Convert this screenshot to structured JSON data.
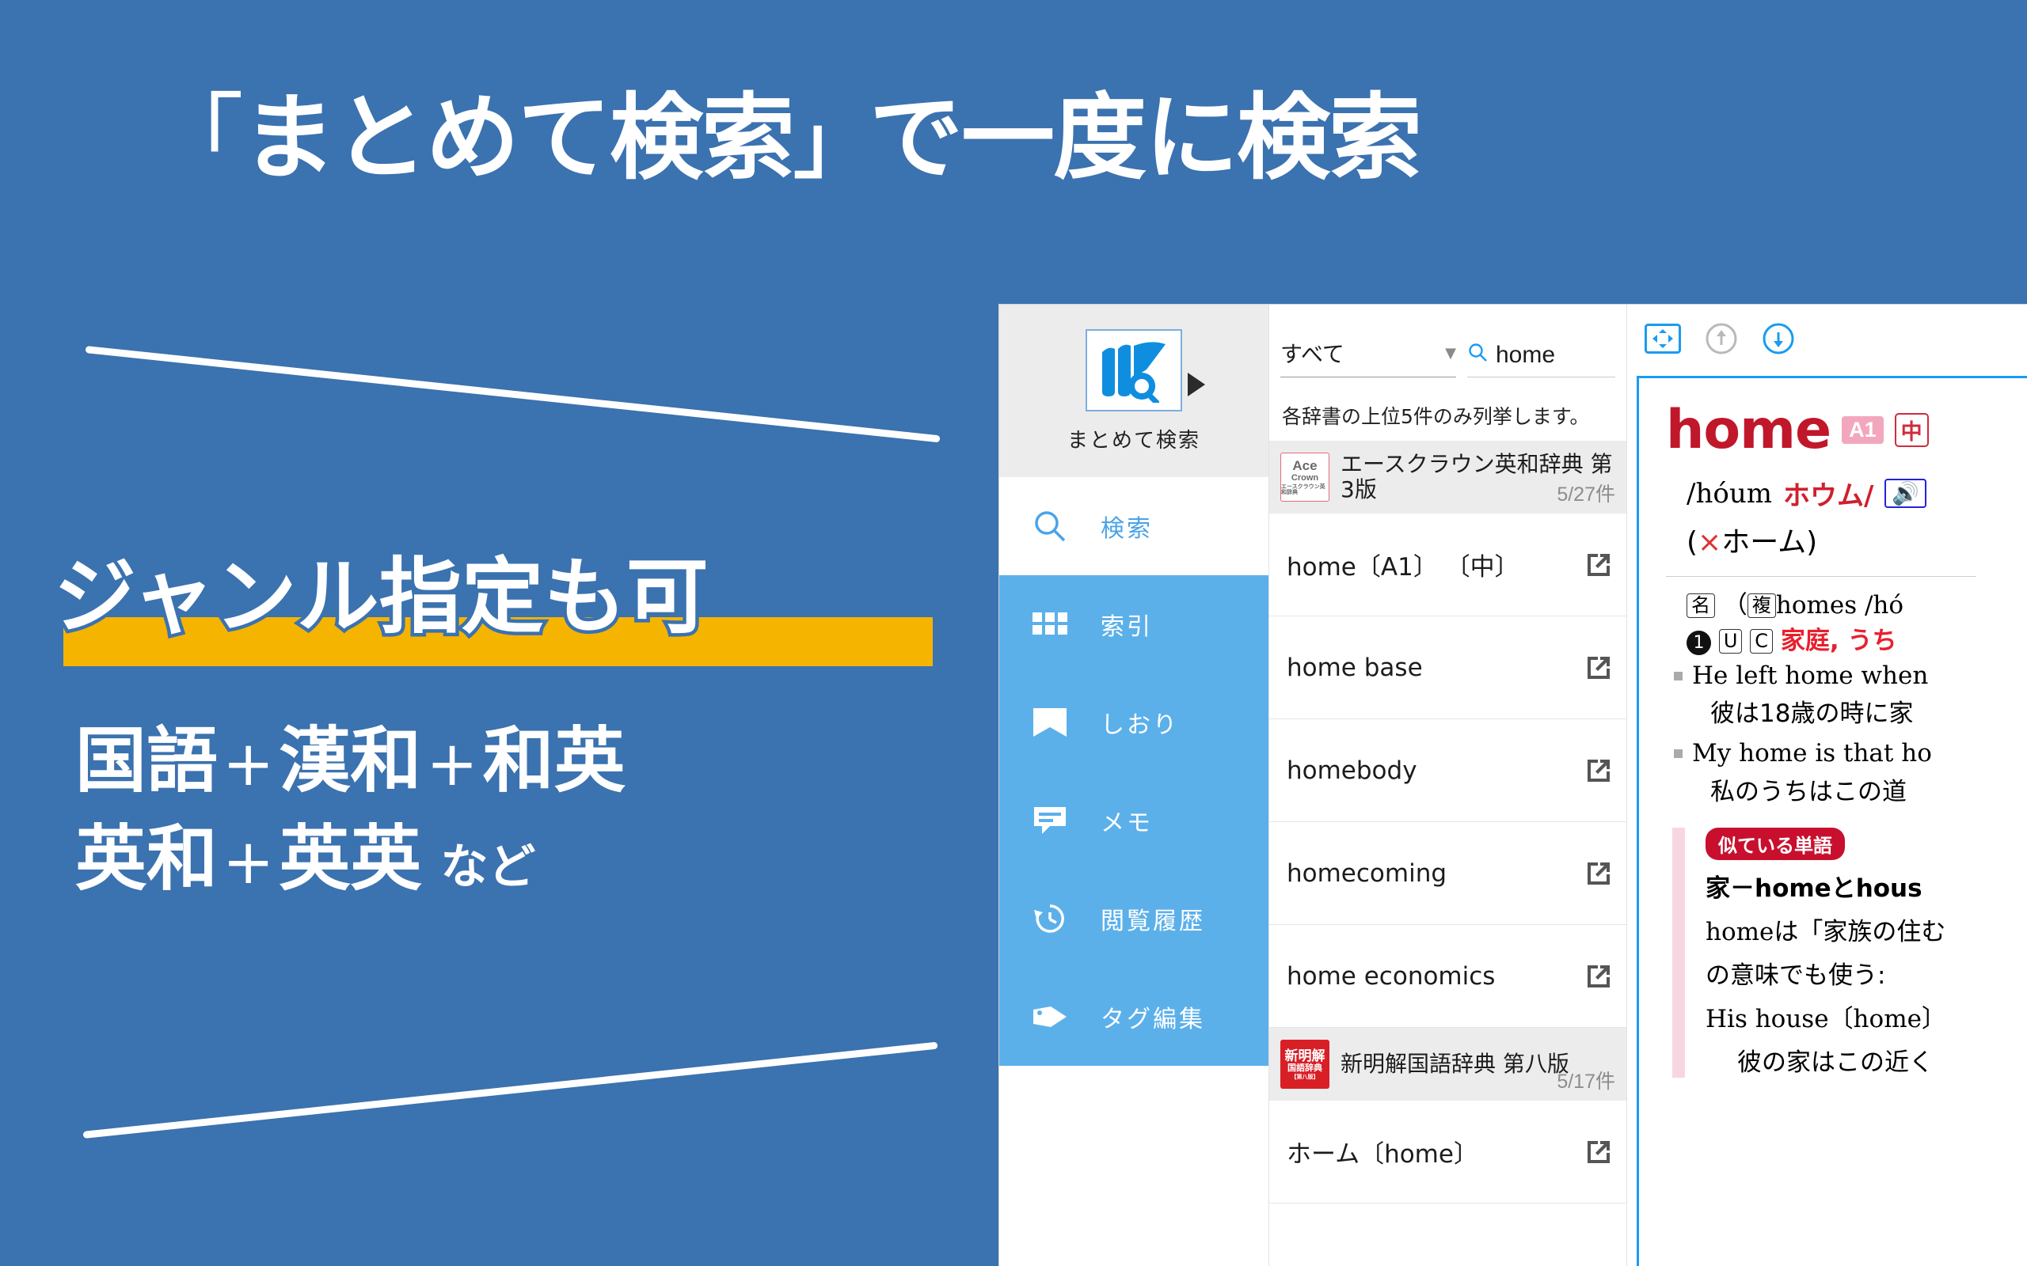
{
  "promo": {
    "headline_open": "「",
    "headline_main": "まとめて検索",
    "headline_close": "」",
    "headline_tail": "で一度に検索",
    "highlight_text": "ジャンル指定も可",
    "highlight_color": "#f5b400",
    "line1_a": "国語",
    "line1_plus1": "+",
    "line1_b": "漢和",
    "line1_plus2": "+",
    "line1_c": "和英",
    "line2_a": "英和",
    "line2_plus1": "+",
    "line2_b": "英英",
    "line2_nado": "など",
    "background_color": "#3b72b0"
  },
  "app": {
    "sidebar": {
      "brand_label": "まとめて検索",
      "items": [
        {
          "label": "検索",
          "icon": "search-icon",
          "active": true
        },
        {
          "label": "索引",
          "icon": "grid-icon",
          "active": false
        },
        {
          "label": "しおり",
          "icon": "bookmark-icon",
          "active": false
        },
        {
          "label": "メモ",
          "icon": "note-icon",
          "active": false
        },
        {
          "label": "閲覧履歴",
          "icon": "history-icon",
          "active": false
        },
        {
          "label": "タグ編集",
          "icon": "tag-icon",
          "active": false
        }
      ]
    },
    "search": {
      "genre_value": "すべて",
      "query_value": "home",
      "note": "各辞書の上位5件のみ列挙します。"
    },
    "result_groups": [
      {
        "logo_l1": "Ace",
        "logo_l2": "Crown",
        "logo_l3": "エースクラウン英和辞典",
        "title": "エースクラウン英和辞典 第3版",
        "count": "5/27件",
        "items": [
          {
            "label": "home〔A1〕 〔中〕"
          },
          {
            "label": "home base"
          },
          {
            "label": "homebody"
          },
          {
            "label": "homecoming"
          },
          {
            "label": "home economics"
          }
        ]
      },
      {
        "logo_l1": "新明解",
        "logo_l2": "国語辞典",
        "logo_l3": "【第八版】",
        "title": "新明解国語辞典 第八版",
        "count": "5/17件",
        "items": [
          {
            "label": "ホーム〔home〕"
          }
        ]
      }
    ],
    "detail": {
      "toolbar": [
        {
          "icon": "fit-screen-icon",
          "state": "active"
        },
        {
          "icon": "arrow-up-circle-icon",
          "state": "disabled"
        },
        {
          "icon": "arrow-down-circle-icon",
          "state": "active"
        }
      ],
      "headword": "home",
      "badge_level": "A1",
      "badge_level_color": "#f3a7bd",
      "badge_cj": "中",
      "badge_cj_color": "#d02b3e",
      "phonetic": "/hóum",
      "phonetic_kana": "ホウム/",
      "speaker_icon": "speaker-icon",
      "phonetic_note_x": "×",
      "phonetic_note": "ホーム)",
      "phonetic_note_open": "(",
      "pos_box": "名",
      "plural_box": "複",
      "plural_text": "homes /hó",
      "sense_num": "❶",
      "sense_box_u": "U",
      "sense_box_c": "C",
      "sense_gloss": "家庭, うち",
      "examples": [
        {
          "en": "He left home when",
          "ja": "彼は18歳の時に家"
        },
        {
          "en": "My home is that ho",
          "ja": "私のうちはこの道"
        }
      ],
      "similar_tag": "似ている単語",
      "similar_lines": [
        "家－homeとhous",
        "homeは「家族の住む",
        "の意味でも使う:",
        "His house〔home〕",
        "彼の家はこの近く"
      ]
    }
  }
}
